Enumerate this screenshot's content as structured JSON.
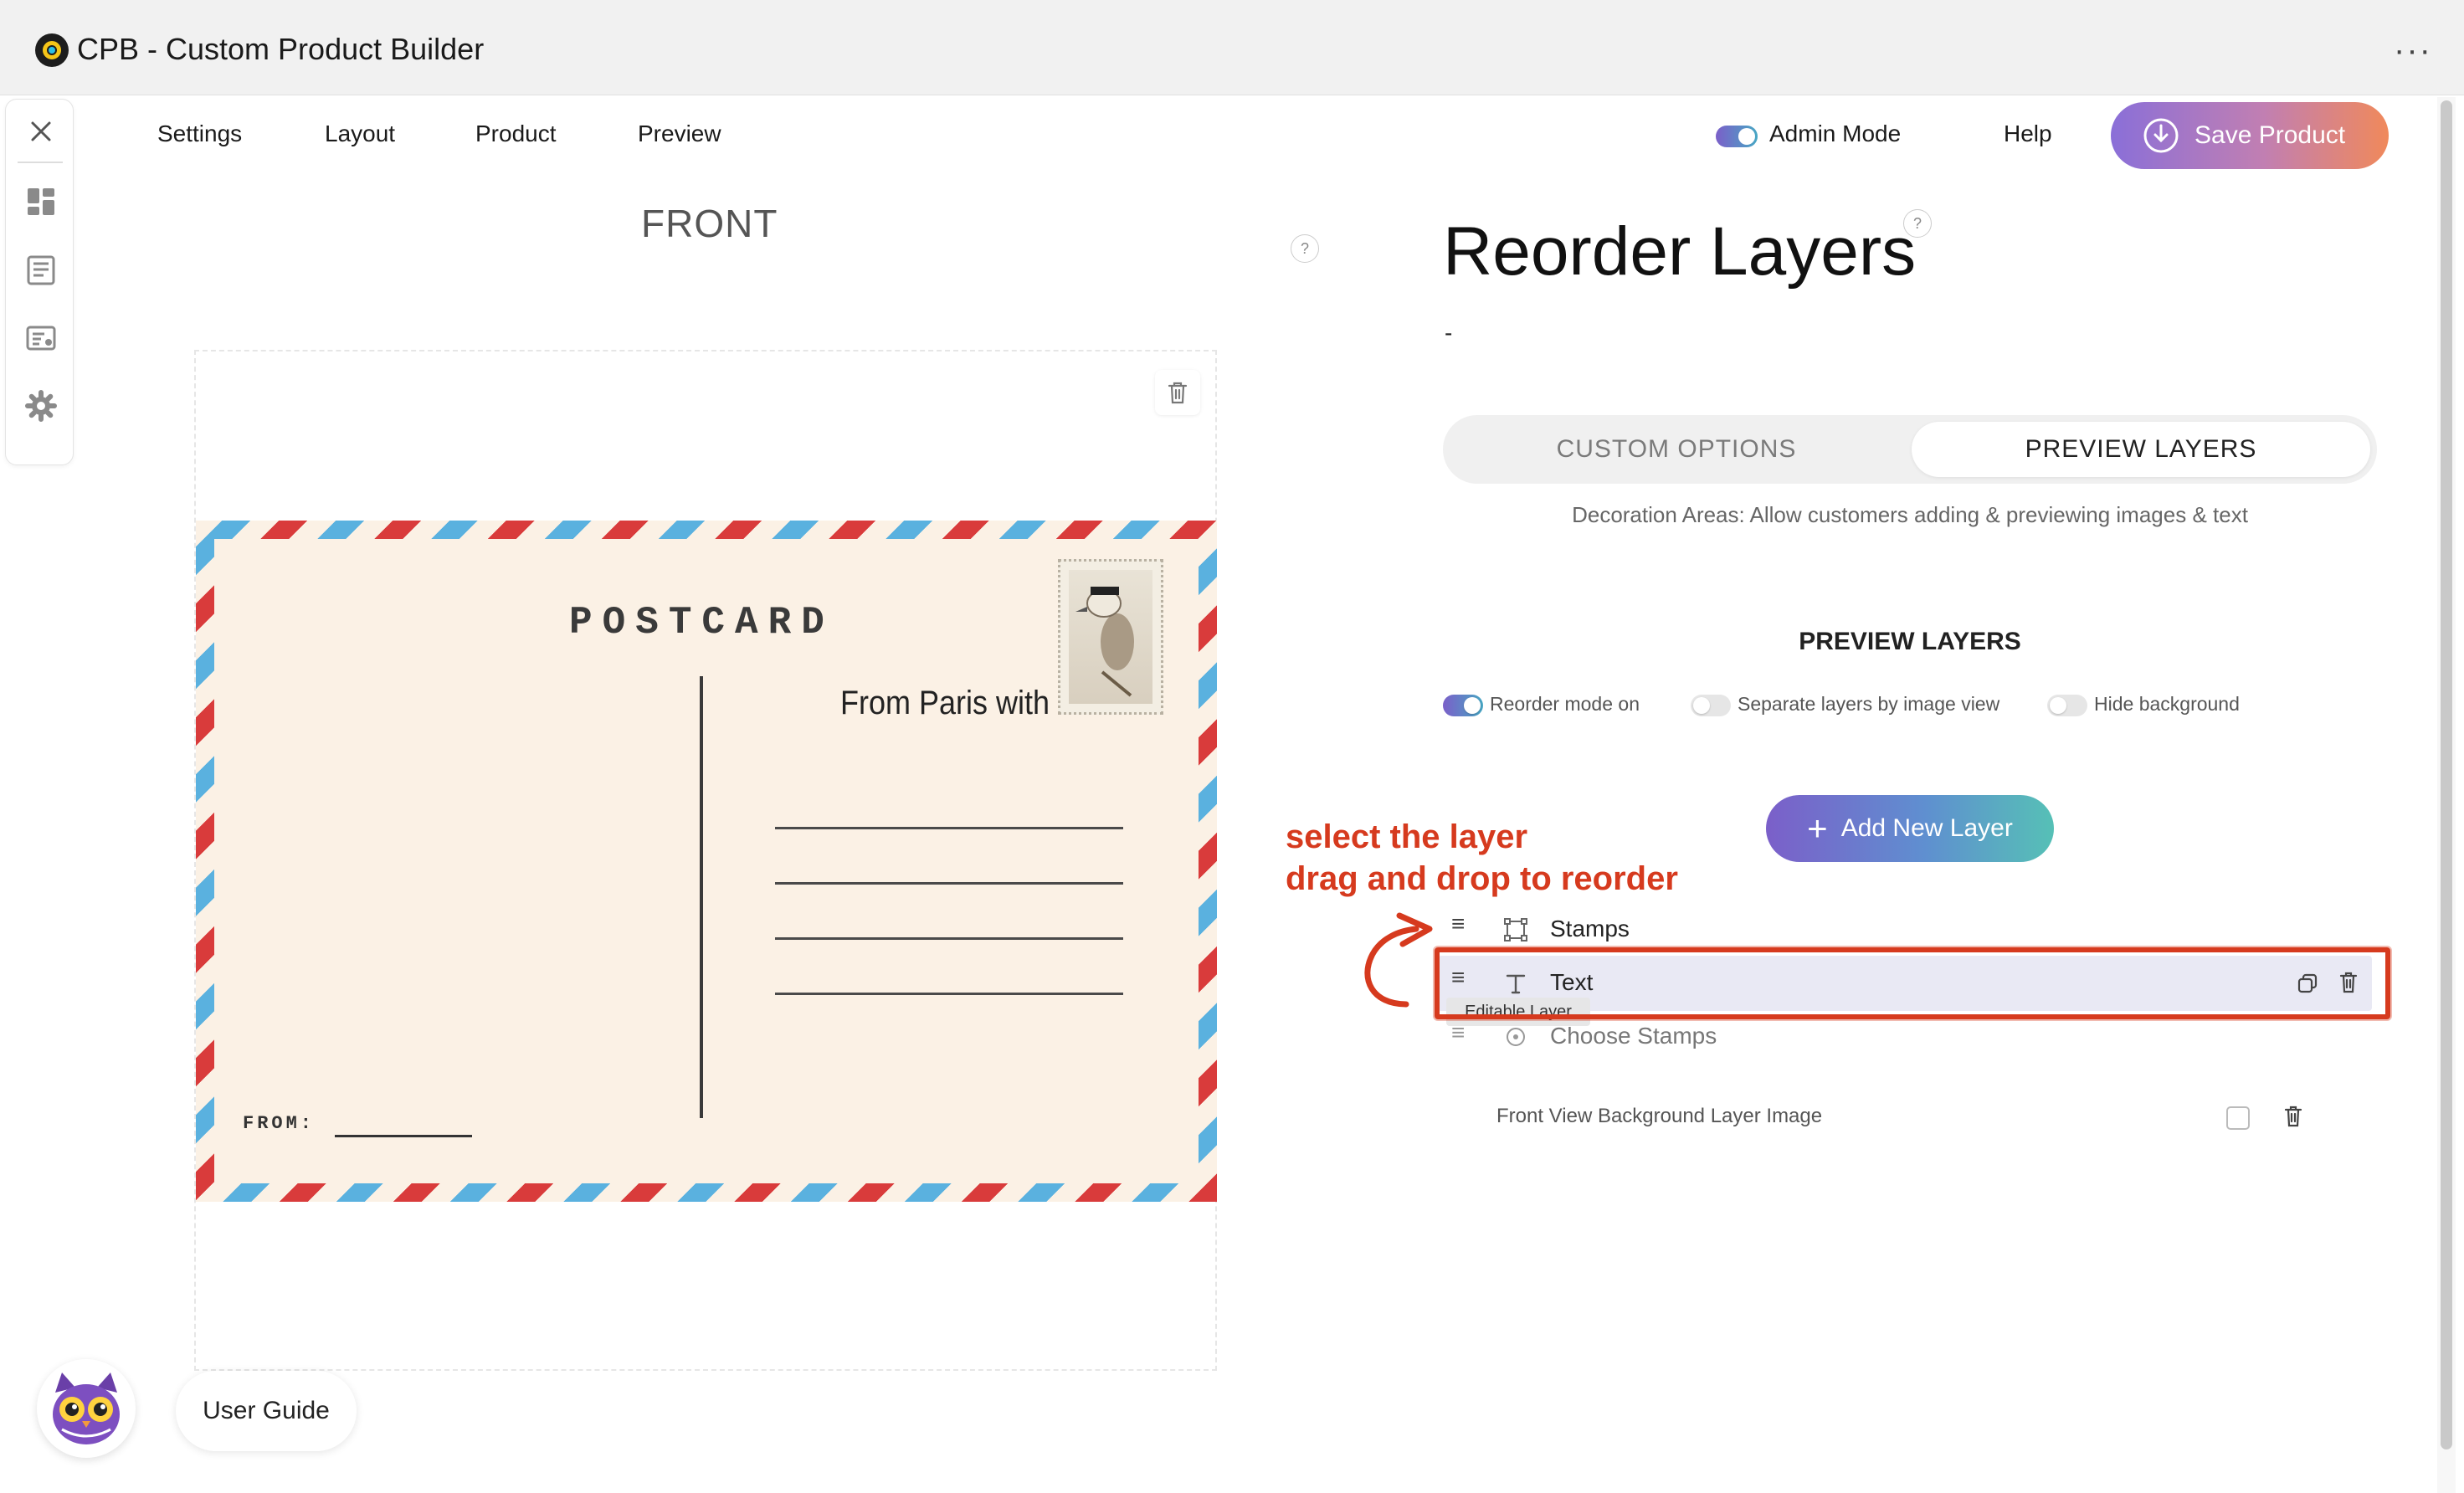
{
  "app": {
    "title": "CPB - Custom Product Builder",
    "logo_icon": "cpb-logo-icon",
    "menu_icon": "more-horizontal-icon",
    "more_glyph": "···"
  },
  "sidebar": {
    "items": [
      {
        "icon": "close-icon"
      },
      {
        "icon": "dashboard-icon"
      },
      {
        "icon": "list-icon"
      },
      {
        "icon": "options-icon"
      },
      {
        "icon": "gear-icon"
      }
    ]
  },
  "nav": {
    "items": [
      {
        "label": "Settings"
      },
      {
        "label": "Layout"
      },
      {
        "label": "Product"
      },
      {
        "label": "Preview"
      }
    ],
    "admin_mode_label": "Admin Mode",
    "admin_mode_on": true,
    "help_label": "Help",
    "save_label": "Save Product"
  },
  "canvas": {
    "view_title": "FRONT",
    "help_glyph": "?",
    "postcard": {
      "title": "POSTCARD",
      "message": "From Paris with love",
      "from_label": "FROM:"
    }
  },
  "panel": {
    "title": "Reorder Layers",
    "help_glyph": "?",
    "description": "-",
    "tabs": [
      {
        "label": "CUSTOM OPTIONS",
        "active": false
      },
      {
        "label": "PREVIEW LAYERS",
        "active": true
      }
    ],
    "subtitle": "Decoration Areas: Allow customers adding & previewing images & text",
    "section_heading": "PREVIEW LAYERS",
    "toggles": [
      {
        "label": "Reorder mode on",
        "on": true
      },
      {
        "label": "Separate layers by image view",
        "on": false
      },
      {
        "label": "Hide background",
        "on": false
      }
    ],
    "add_layer_label": "Add New Layer",
    "add_layer_glyph": "+",
    "layers": [
      {
        "label": "Stamps",
        "icon": "frame-icon"
      },
      {
        "label": "Text",
        "icon": "text-icon",
        "selected": true
      },
      {
        "label": "Choose Stamps",
        "icon": "options-circle-icon"
      }
    ],
    "drag_glyph": "≡",
    "tooltip": "Editable Layer",
    "background_layer_label": "Front View Background Layer Image"
  },
  "annotation": {
    "line1": "select the layer",
    "line2": "drag and drop to reorder",
    "color": "#d63a1e"
  },
  "footer": {
    "guide_label": "User Guide",
    "mascot_icon": "owl-mascot-icon"
  },
  "colors": {
    "accent_purple": "#7b5fc9",
    "accent_orange": "#f0895b",
    "airmail_red": "#d93b3b",
    "airmail_blue": "#5ab1df",
    "postcard_bg": "#fbf1e5"
  }
}
